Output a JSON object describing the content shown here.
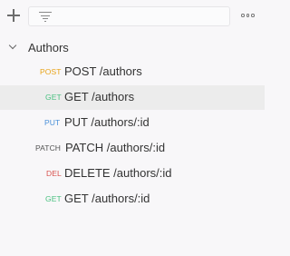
{
  "toolbar": {
    "add_icon": "plus-icon",
    "filter_icon": "filter-funnel-icon",
    "more_icon": "more-horizontal-icon",
    "filter_placeholder": ""
  },
  "folder": {
    "name": "Authors",
    "expanded": true,
    "icon": "chevron-down-icon"
  },
  "colors": {
    "post": "#e8a317",
    "get": "#49c180",
    "put": "#4a90d9",
    "patch": "#555555",
    "delete": "#d9534f",
    "active_row": "#ececec"
  },
  "requests": [
    {
      "method": "POST",
      "label": "POST /authors",
      "active": false
    },
    {
      "method": "GET",
      "label": "GET /authors",
      "active": true
    },
    {
      "method": "PUT",
      "label": "PUT /authors/:id",
      "active": false
    },
    {
      "method": "PATCH",
      "label": "PATCH /authors/:id",
      "active": false
    },
    {
      "method": "DEL",
      "label": "DELETE /authors/:id",
      "active": false
    },
    {
      "method": "GET",
      "label": "GET /authors/:id",
      "active": false
    }
  ]
}
